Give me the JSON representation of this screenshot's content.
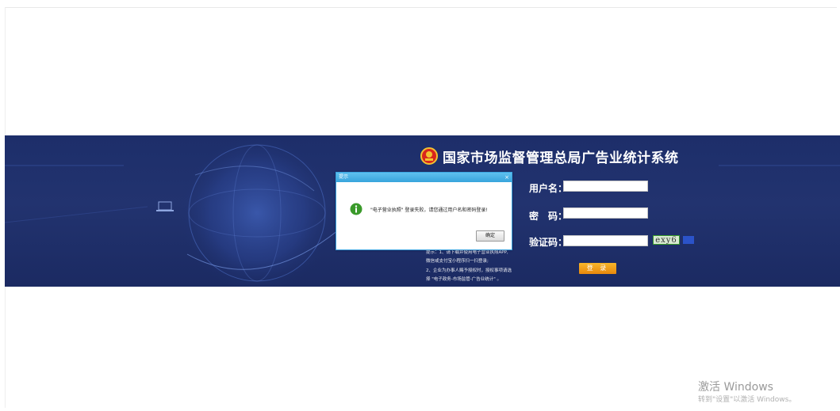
{
  "app": {
    "title": "国家市场监督管理总局广告业统计系统"
  },
  "form": {
    "username_label": "用户名：",
    "password_label": "密　码：",
    "captcha_label": "验证码：",
    "username_value": "",
    "password_value": "",
    "captcha_value": "",
    "captcha_text": "exy6",
    "login_label": "登 录"
  },
  "hint": {
    "line1": "提示：1、请下载并使用电子营业执照APP,",
    "line2": "微信或支付宝小程序扫一扫登录;",
    "line3": "2、企业为办事人赐予授权时，授权事项请选",
    "line4": "择 \"电子政务-市场监管-广告业统计\" 。"
  },
  "dialog": {
    "title": "提示",
    "close": "×",
    "message": "\"电子营业执照\" 登录失败，请您通过用户名和密码登录!",
    "ok_label": "确定"
  },
  "watermark": {
    "line1": "激活 Windows",
    "line2": "转到\"设置\"以激活 Windows。"
  },
  "colors": {
    "banner": "#1f2f6b",
    "dialog_header": "#38a4dc",
    "login_button": "#f0a020",
    "captcha_border": "#3a9a2a"
  }
}
